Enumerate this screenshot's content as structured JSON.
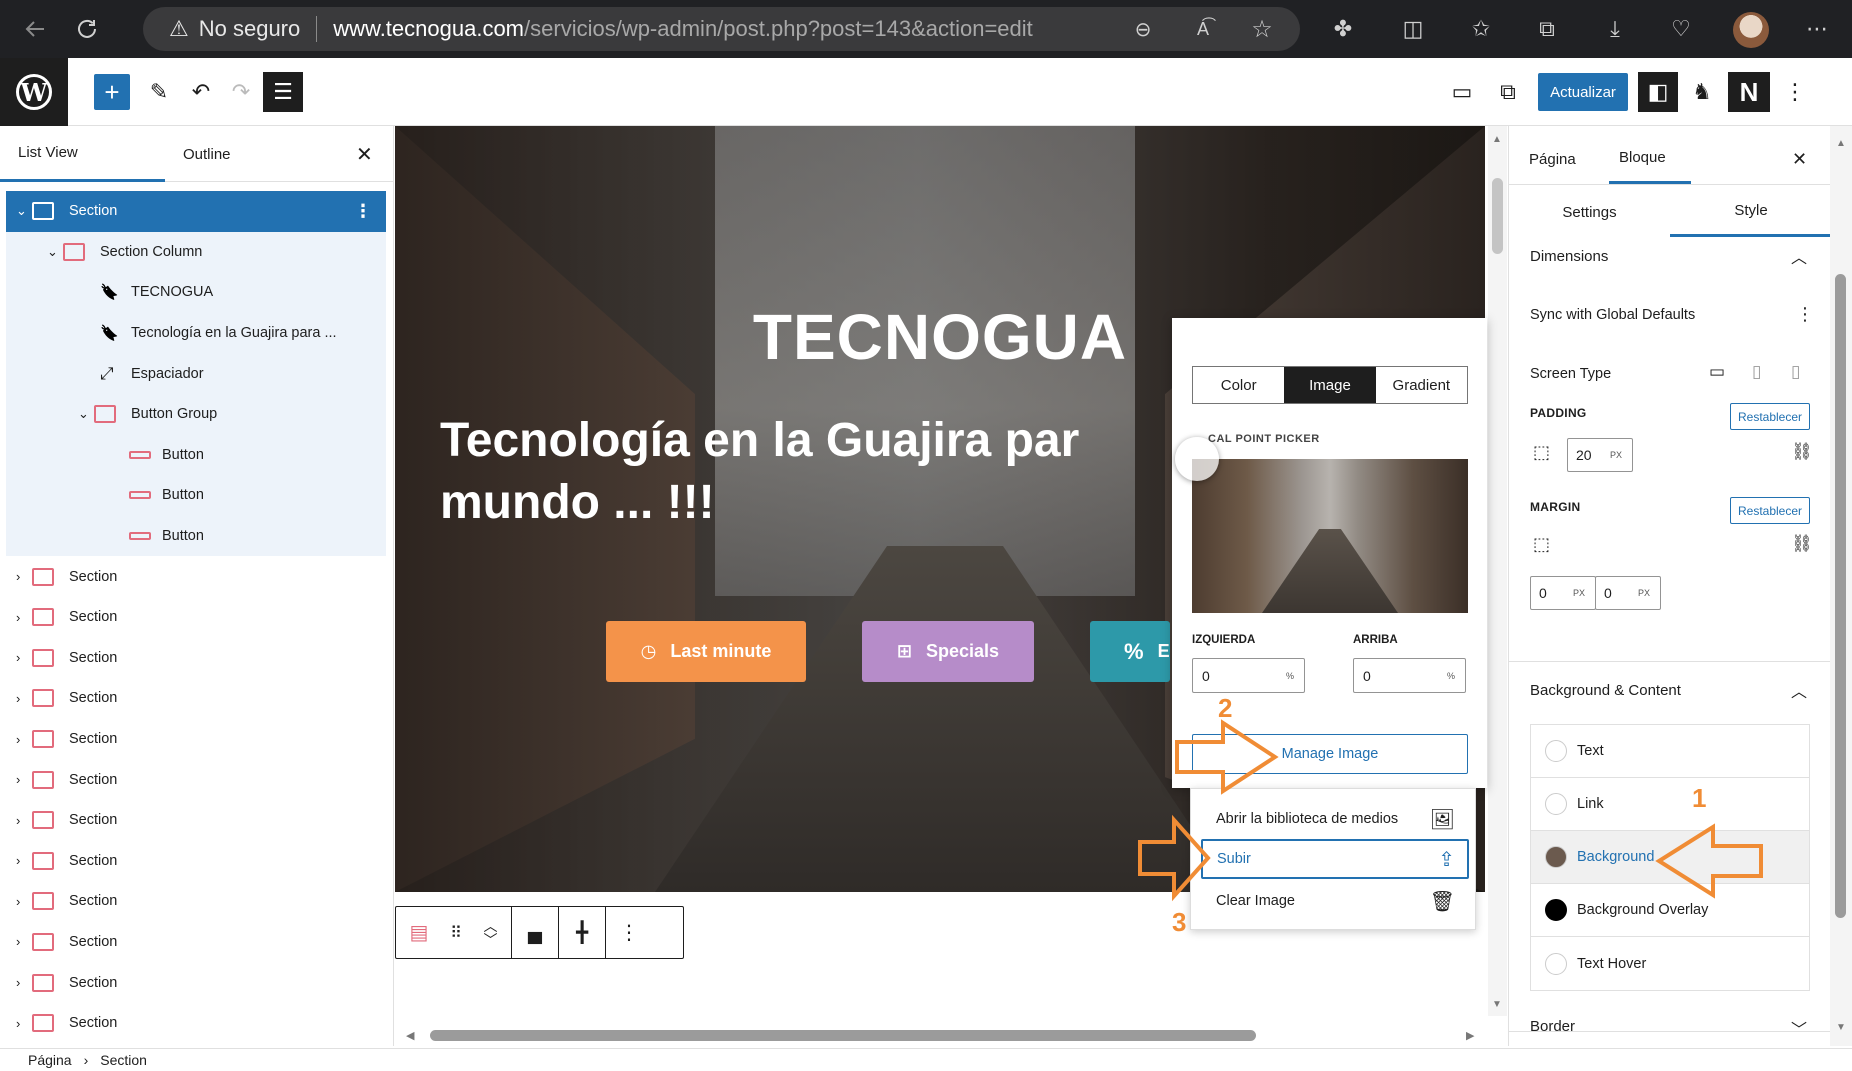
{
  "browser": {
    "security_label": "No seguro",
    "url_host": "www.tecnogua.com",
    "url_path": "/servicios/wp-admin/post.php?post=143&action=edit"
  },
  "toolbar": {
    "update_label": "Actualizar",
    "n_label": "N"
  },
  "left_panel": {
    "tab_list": "List View",
    "tab_outline": "Outline",
    "items": [
      {
        "label": "Section",
        "level": 0,
        "expanded": true,
        "selected": true,
        "icon": "section-icon"
      },
      {
        "label": "Section Column",
        "level": 1,
        "expanded": true,
        "icon": "column-icon"
      },
      {
        "label": "TECNOGUA",
        "level": 2,
        "icon": "bookmark-icon"
      },
      {
        "label": "Tecnología en la Guajira para ...",
        "level": 2,
        "icon": "bookmark-icon"
      },
      {
        "label": "Espaciador",
        "level": 2,
        "icon": "resize-icon"
      },
      {
        "label": "Button Group",
        "level": 2,
        "expanded": true,
        "icon": "button-group-icon"
      },
      {
        "label": "Button",
        "level": 3,
        "icon": "button-icon"
      },
      {
        "label": "Button",
        "level": 3,
        "icon": "button-icon"
      },
      {
        "label": "Button",
        "level": 3,
        "icon": "button-icon"
      },
      {
        "label": "Section",
        "level": 0,
        "icon": "section-icon"
      },
      {
        "label": "Section",
        "level": 0,
        "icon": "section-icon"
      },
      {
        "label": "Section",
        "level": 0,
        "icon": "section-icon"
      },
      {
        "label": "Section",
        "level": 0,
        "icon": "section-icon"
      },
      {
        "label": "Section",
        "level": 0,
        "icon": "section-icon"
      },
      {
        "label": "Section",
        "level": 0,
        "icon": "section-icon"
      },
      {
        "label": "Section",
        "level": 0,
        "icon": "section-icon"
      },
      {
        "label": "Section",
        "level": 0,
        "icon": "section-icon"
      },
      {
        "label": "Section",
        "level": 0,
        "icon": "section-icon"
      },
      {
        "label": "Section",
        "level": 0,
        "icon": "section-icon"
      },
      {
        "label": "Section",
        "level": 0,
        "icon": "section-icon"
      },
      {
        "label": "Section",
        "level": 0,
        "icon": "section-icon"
      }
    ]
  },
  "breadcrumb": {
    "root": "Página",
    "current": "Section"
  },
  "canvas": {
    "title": "TECNOGUA",
    "subtitle_line1": "Tecnología en la Guajira par",
    "subtitle_line2": "mundo ... !!!",
    "buttons": [
      {
        "label": "Last minute",
        "color": "#f4934a"
      },
      {
        "label": "Specials",
        "color": "#b68cc9"
      },
      {
        "label": "E",
        "color": "#2d99a9"
      }
    ]
  },
  "bg_popover": {
    "seg_color": "Color",
    "seg_image": "Image",
    "seg_gradient": "Gradient",
    "focal_label": "CAL POINT PICKER",
    "left_label": "IZQUIERDA",
    "top_label": "ARRIBA",
    "left_value": "0",
    "top_value": "0",
    "unit": "%",
    "manage_label": "Manage Image"
  },
  "image_menu": {
    "open_library": "Abrir la biblioteca de medios",
    "upload": "Subir",
    "clear": "Clear Image"
  },
  "right_panel": {
    "tab_page": "Página",
    "tab_block": "Bloque",
    "sub_settings": "Settings",
    "sub_style": "Style",
    "dimensions": "Dimensions",
    "sync": "Sync with Global Defaults",
    "screen_type": "Screen Type",
    "padding": "PADDING",
    "margin": "MARGIN",
    "reset": "Restablecer",
    "padding_value": "20",
    "margin_values": [
      "0",
      "0"
    ],
    "unit": "PX",
    "bg_content": "Background & Content",
    "colors": [
      {
        "label": "Text",
        "swatch": "#ffffff"
      },
      {
        "label": "Link",
        "swatch": "#ffffff"
      },
      {
        "label": "Background",
        "swatch": "#6b5a4e"
      },
      {
        "label": "Background Overlay",
        "swatch": "#000000"
      },
      {
        "label": "Text Hover",
        "swatch": "#ffffff"
      }
    ],
    "border": "Border"
  },
  "annotations": {
    "n1": "1",
    "n2": "2",
    "n3": "3",
    "color": "#f08c35"
  }
}
